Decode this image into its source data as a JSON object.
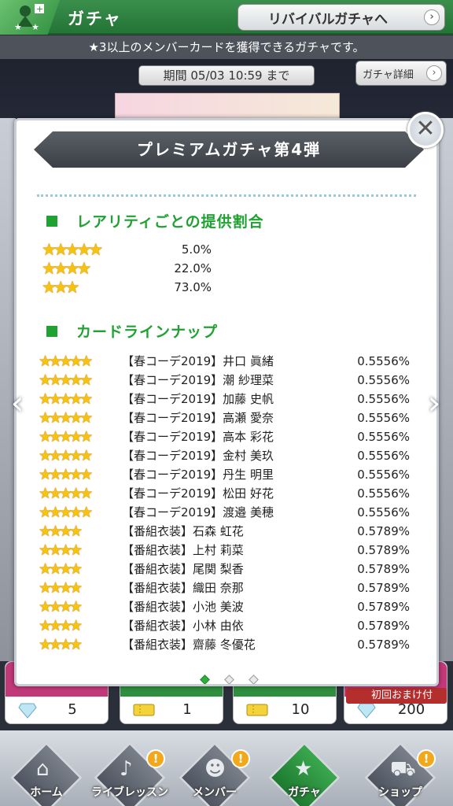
{
  "header": {
    "title": "ガチャ",
    "revival_button": "リバイバルガチャへ",
    "subtitle": "★3以上のメンバーカードを獲得できるガチャです。",
    "period": "期間 05/03 10:59 まで",
    "detail_button": "ガチャ詳細",
    "chevron_icon": "chevron-right-icon"
  },
  "modal": {
    "title": "プレミアムガチャ第4弾",
    "rarity_heading": "レアリティごとの提供割合",
    "rarity": [
      {
        "stars": 5,
        "pct": "5.0%"
      },
      {
        "stars": 4,
        "pct": "22.0%"
      },
      {
        "stars": 3,
        "pct": "73.0%"
      }
    ],
    "lineup_heading": "カードラインナップ",
    "cards": [
      {
        "stars": 5,
        "name": "【春コーデ2019】井口 眞緒",
        "prob": "0.5556%"
      },
      {
        "stars": 5,
        "name": "【春コーデ2019】潮 紗理菜",
        "prob": "0.5556%"
      },
      {
        "stars": 5,
        "name": "【春コーデ2019】加藤 史帆",
        "prob": "0.5556%"
      },
      {
        "stars": 5,
        "name": "【春コーデ2019】高瀬 愛奈",
        "prob": "0.5556%"
      },
      {
        "stars": 5,
        "name": "【春コーデ2019】高本 彩花",
        "prob": "0.5556%"
      },
      {
        "stars": 5,
        "name": "【春コーデ2019】金村 美玖",
        "prob": "0.5556%"
      },
      {
        "stars": 5,
        "name": "【春コーデ2019】丹生 明里",
        "prob": "0.5556%"
      },
      {
        "stars": 5,
        "name": "【春コーデ2019】松田 好花",
        "prob": "0.5556%"
      },
      {
        "stars": 5,
        "name": "【春コーデ2019】渡邉 美穂",
        "prob": "0.5556%"
      },
      {
        "stars": 4,
        "name": "【番組衣装】石森 虹花",
        "prob": "0.5789%"
      },
      {
        "stars": 4,
        "name": "【番組衣装】上村 莉菜",
        "prob": "0.5789%"
      },
      {
        "stars": 4,
        "name": "【番組衣装】尾関 梨香",
        "prob": "0.5789%"
      },
      {
        "stars": 4,
        "name": "【番組衣装】織田 奈那",
        "prob": "0.5789%"
      },
      {
        "stars": 4,
        "name": "【番組衣装】小池 美波",
        "prob": "0.5789%"
      },
      {
        "stars": 4,
        "name": "【番組衣装】小林 由依",
        "prob": "0.5789%"
      },
      {
        "stars": 4,
        "name": "【番組衣装】齋藤 冬優花",
        "prob": "0.5789%"
      }
    ],
    "pages": 3,
    "current_page": 1,
    "close_icon": "close-icon",
    "prev_icon": "chevron-left-icon",
    "next_icon": "chevron-right-icon"
  },
  "bottom": {
    "costs": [
      {
        "icon": "diamond-icon",
        "value": "5",
        "band": "#c2397a"
      },
      {
        "icon": "ticket-icon",
        "value": "1",
        "band": "#2f8f3f"
      },
      {
        "icon": "ticket-icon",
        "value": "10",
        "band": "#2f8f3f"
      },
      {
        "icon": "diamond-icon",
        "value": "200",
        "band": "#c2397a"
      }
    ],
    "bonus_label": "初回おまけ付"
  },
  "tabs": [
    {
      "label": "ホーム",
      "icon": "home-icon",
      "badge": false
    },
    {
      "label": "ライブレッスン",
      "icon": "lesson-icon",
      "badge": true
    },
    {
      "label": "メンバー",
      "icon": "member-icon",
      "badge": true
    },
    {
      "label": "ガチャ",
      "icon": "gacha-icon",
      "badge": false,
      "active": true
    },
    {
      "label": "ショップ",
      "icon": "cart-icon",
      "badge": true
    }
  ],
  "badge_text": "!"
}
